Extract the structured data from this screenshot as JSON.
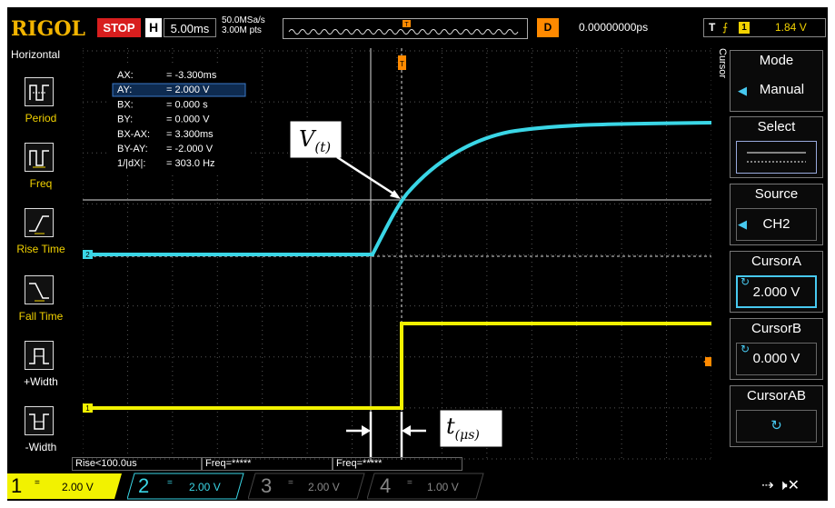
{
  "top_bar": {
    "brand": "RIGOL",
    "run_state": "STOP",
    "horizontal_label": "H",
    "timebase": "5.00ms",
    "sample_rate": "50.0MSa/s",
    "memory_depth": "3.00M pts",
    "delay_label": "D",
    "delay_value": "0.00000000ps",
    "trigger_type": "T",
    "trigger_source": "1",
    "trigger_level": "1.84 V"
  },
  "left_menu": {
    "title": "Horizontal",
    "items": [
      {
        "label": "Period",
        "icon": "period-icon"
      },
      {
        "label": "Freq",
        "icon": "freq-icon"
      },
      {
        "label": "Rise Time",
        "icon": "rise-time-icon"
      },
      {
        "label": "Fall Time",
        "icon": "fall-time-icon"
      },
      {
        "label": "+Width",
        "icon": "positive-width-icon"
      },
      {
        "label": "-Width",
        "icon": "negative-width-icon"
      }
    ]
  },
  "cursor_readout": [
    {
      "name": "AX:",
      "value": "= -3.300ms"
    },
    {
      "name": "AY:",
      "value": "= 2.000 V"
    },
    {
      "name": "BX:",
      "value": "= 0.000 s"
    },
    {
      "name": "BY:",
      "value": "= 0.000 V"
    },
    {
      "name": "BX-AX:",
      "value": "= 3.300ms"
    },
    {
      "name": "BY-AY:",
      "value": "= -2.000 V"
    },
    {
      "name": "1/|dX|:",
      "value": "= 303.0 Hz"
    }
  ],
  "annotations": {
    "voltage": {
      "main": "V",
      "sub": "(t)"
    },
    "time": {
      "main": "t",
      "sub": "(μs)"
    }
  },
  "right_menu": {
    "title": "Cursor",
    "buttons": [
      {
        "header": "Mode",
        "body": "Manual"
      },
      {
        "header": "Select",
        "body": ""
      },
      {
        "header": "Source",
        "body": "CH2"
      },
      {
        "header": "CursorA",
        "body": "2.000 V"
      },
      {
        "header": "CursorB",
        "body": "0.000 V"
      },
      {
        "header": "CursorAB",
        "body": ""
      }
    ]
  },
  "bottom_status": {
    "rise": "Rise<100.0us",
    "freq1": "Freq=*****",
    "freq2": "Freq=*****"
  },
  "channels": [
    {
      "num": "1",
      "coupling": "=",
      "scale": "2.00 V",
      "color": "#f2f200",
      "active": true
    },
    {
      "num": "2",
      "coupling": "=",
      "scale": "2.00 V",
      "color": "#3ad6e6",
      "active": true
    },
    {
      "num": "3",
      "coupling": "=",
      "scale": "2.00 V",
      "color": "#888888",
      "active": false
    },
    {
      "num": "4",
      "coupling": "=",
      "scale": "1.00 V",
      "color": "#888888",
      "active": false
    }
  ],
  "colors": {
    "ch1": "#f2f200",
    "ch2": "#3ad6e6",
    "brand": "#f2b400",
    "stop": "#d81e1e",
    "trigger": "#ff8a00"
  }
}
